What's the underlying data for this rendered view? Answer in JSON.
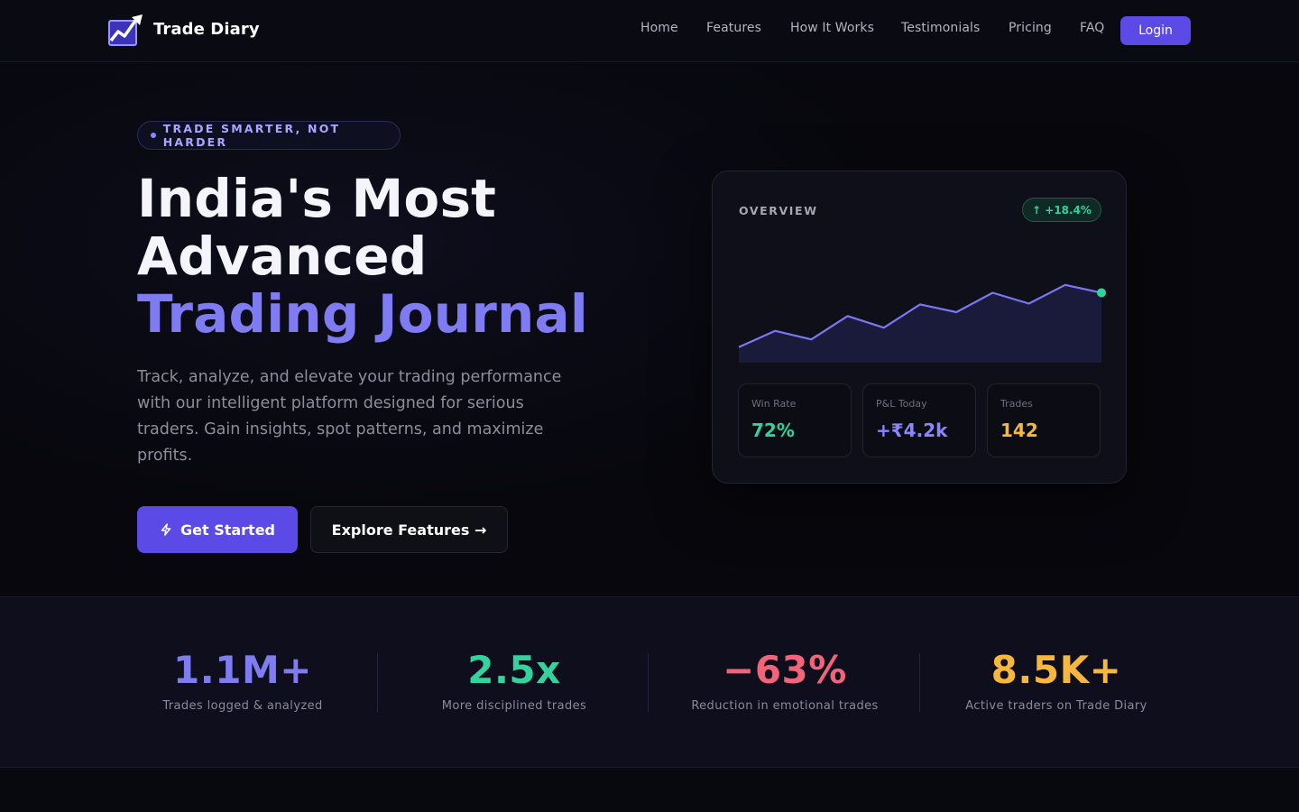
{
  "nav": {
    "brand": "Trade Diary",
    "logo_icon": "chart-trend-icon",
    "links": [
      "Home",
      "Features",
      "How It Works",
      "Testimonials",
      "Pricing",
      "FAQ"
    ],
    "login_label": "Login"
  },
  "hero": {
    "tag": "TRADE SMARTER, NOT HARDER",
    "title_line1": "India's Most",
    "title_line2": "Advanced",
    "title_line3": "Trading Journal",
    "description": "Track, analyze, and elevate your trading performance with our intelligent platform designed for serious traders. Gain insights, spot patterns, and maximize profits.",
    "primary_cta": "Get Started",
    "primary_cta_icon": "bolt-icon",
    "secondary_cta": "Explore Features →"
  },
  "overview": {
    "title": "OVERVIEW",
    "badge": "↑ +18.4%",
    "stats": [
      {
        "label": "Win Rate",
        "value": "72%",
        "color": "#2fd49a"
      },
      {
        "label": "P&L Today",
        "value": "+₹4.2k",
        "color": "#8a86ff"
      },
      {
        "label": "Trades",
        "value": "142",
        "color": "#f6b73c"
      }
    ]
  },
  "chart_data": {
    "type": "area",
    "x": [
      0,
      1,
      2,
      3,
      4,
      5,
      6,
      7,
      8,
      9,
      10
    ],
    "values": [
      20,
      41,
      30,
      60,
      45,
      75,
      65,
      90,
      76,
      100,
      90
    ],
    "ylim": [
      0,
      130
    ],
    "color": "#7a78f0",
    "fill": "#1a1a3a",
    "last_point_color": "#2fd49a"
  },
  "metrics": [
    {
      "value": "1.1M+",
      "label": "Trades logged & analyzed",
      "color": "#7f7cf3"
    },
    {
      "value": "2.5x",
      "label": "More disciplined trades",
      "color": "#34d39e"
    },
    {
      "value": "−63%",
      "label": "Reduction in emotional trades",
      "color": "#f2647a"
    },
    {
      "value": "8.5K+",
      "label": "Active traders on Trade Diary",
      "color": "#f6b73c"
    }
  ],
  "colors": {
    "accent": "#5b4ae6",
    "accent_text": "#7f7cf3",
    "background": "#07070d"
  }
}
